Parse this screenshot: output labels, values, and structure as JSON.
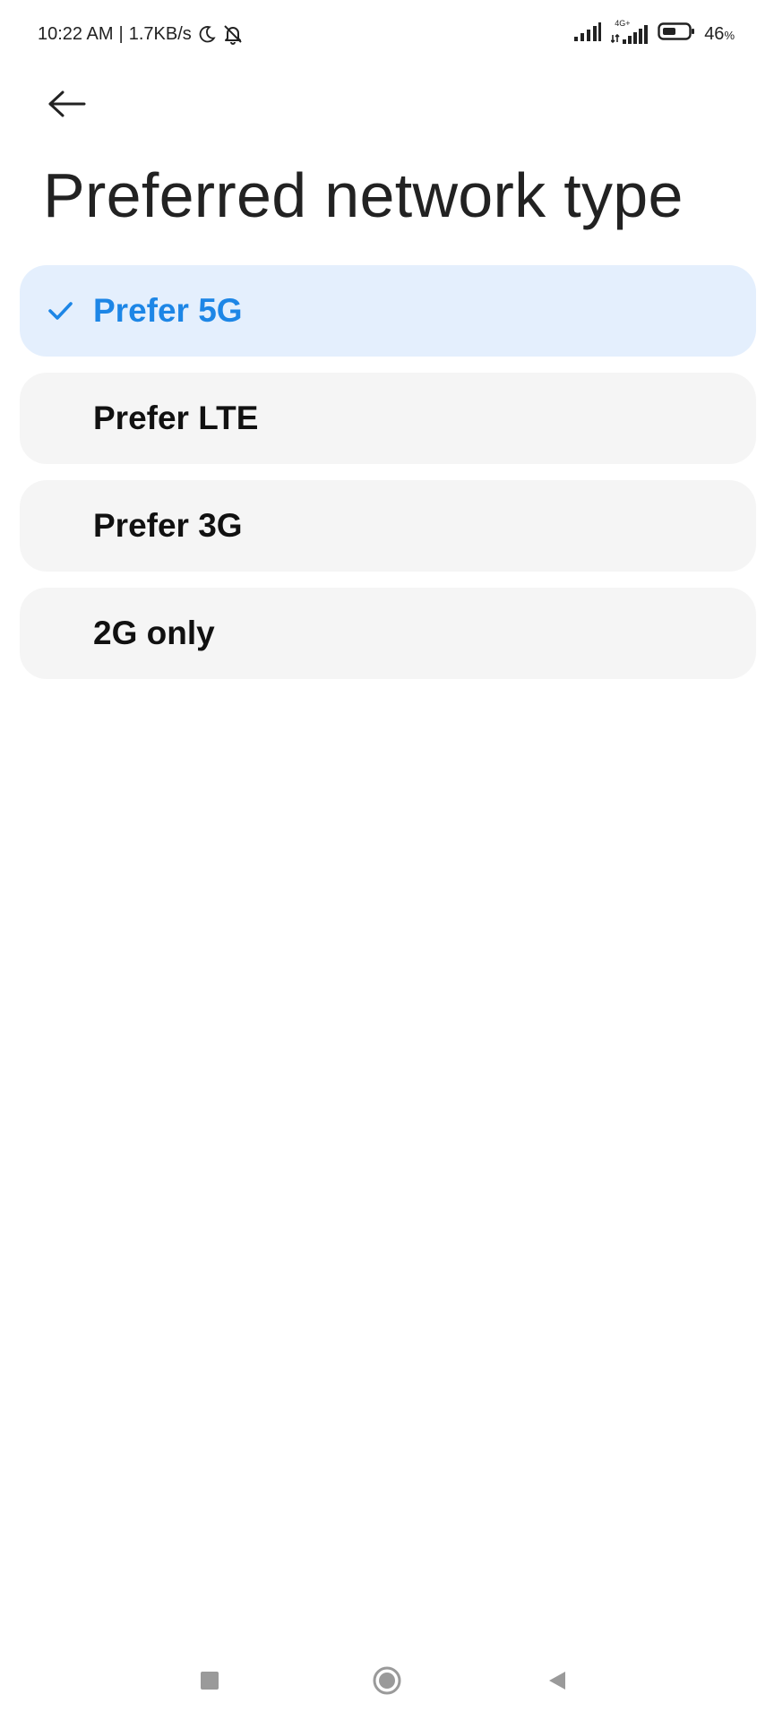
{
  "status_bar": {
    "time": "10:22 AM",
    "separator": "|",
    "speed": "1.7KB/s",
    "icons": [
      "moon-icon",
      "bell-off-icon",
      "signal-icon",
      "signal-4g-icon",
      "battery-icon"
    ],
    "network_label": "4G+",
    "battery_percent": "46",
    "battery_unit": "%"
  },
  "header": {
    "back_icon": "arrow-left-icon",
    "title": "Preferred network type"
  },
  "options": [
    {
      "label": "Prefer 5G",
      "selected": true
    },
    {
      "label": "Prefer LTE",
      "selected": false
    },
    {
      "label": "Prefer 3G",
      "selected": false
    },
    {
      "label": "2G only",
      "selected": false
    }
  ],
  "nav_bar": {
    "icons": [
      "square-icon",
      "home-circle-icon",
      "back-triangle-icon"
    ]
  },
  "colors": {
    "accent": "#1d86e6",
    "selected_bg": "#e4effd",
    "option_bg": "#f5f5f5",
    "text": "#222222"
  }
}
